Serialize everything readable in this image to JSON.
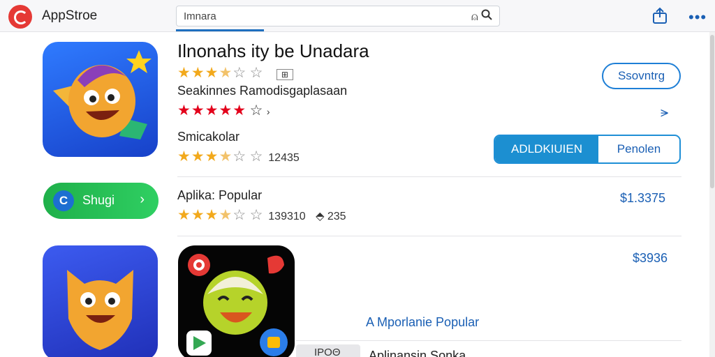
{
  "header": {
    "app_title": "AppStroe",
    "search_value": "Imnara",
    "icons": [
      "logo-icon",
      "mic-icon",
      "search-icon",
      "share-icon",
      "more-icon"
    ]
  },
  "featured": {
    "title": "Ilnonahs ity be Unadara",
    "rating_box": "⊞",
    "subtitle": "Seakinnes Ramodisgaplasaan",
    "rating_arrow": "›",
    "developer": "Smicakolar",
    "reviews": "12435",
    "stars_top": 3.5,
    "stars_red": 5,
    "stars_dev": 3.5
  },
  "actions": {
    "outline_button": "Ssovntrg",
    "chevron_link": "⪫",
    "seg_primary": "ADLDKIUIEN",
    "seg_secondary": "Penolen"
  },
  "popular_row": {
    "pill_badge": "C",
    "pill_label": "Shugi",
    "pill_arrow": "›",
    "title": "Aplika: Popular",
    "count": "139310",
    "downloads": "235",
    "price": "$1.3375",
    "stars": 3.5
  },
  "bottom_row": {
    "price": "$3936",
    "link": "A Mporlanie Popular",
    "tab_label": "ΙΡΟΘ",
    "partial_text": "Aplinansin Sonka"
  },
  "colors": {
    "accent": "#1a5fb4",
    "segment_fill": "#1c8fd1",
    "pill_green": "#2fcf62",
    "star_gold": "#f2a91c",
    "star_red": "#e3001b"
  }
}
